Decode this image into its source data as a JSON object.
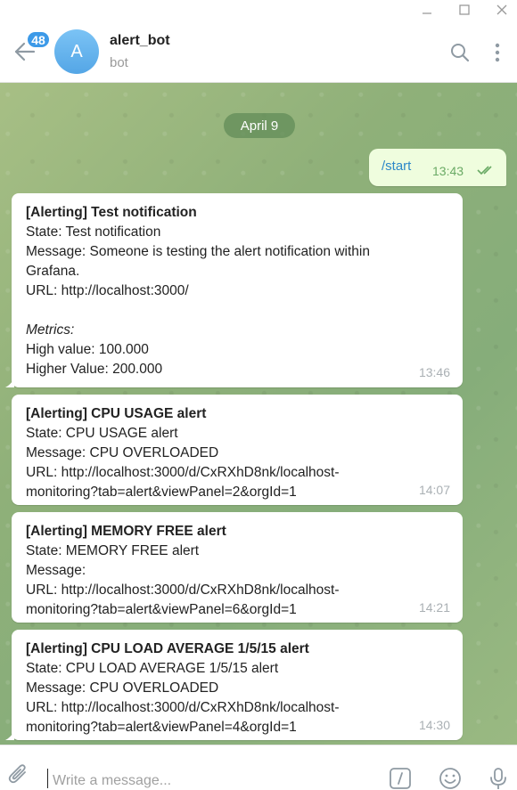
{
  "window": {
    "minimize_icon": "minimize-icon",
    "maximize_icon": "maximize-icon",
    "close_icon": "close-icon"
  },
  "header": {
    "unread_count": "48",
    "avatar_letter": "A",
    "title": "alert_bot",
    "subtitle": "bot"
  },
  "chat": {
    "date": "April 9",
    "outgoing": {
      "text": "/start",
      "time": "13:43"
    },
    "messages": [
      {
        "lines": [
          "[Alerting] Test notification",
          "State: Test notification",
          "Message: Someone is testing the alert notification within",
          "Grafana.",
          "URL: http://localhost:3000/",
          "",
          "Metrics:",
          "High value: 100.000",
          "Higher Value: 200.000"
        ],
        "time": "13:46"
      },
      {
        "lines": [
          "[Alerting] CPU USAGE alert",
          "State: CPU USAGE alert",
          "Message: CPU OVERLOADED",
          "URL: http://localhost:3000/d/CxRXhD8nk/localhost-",
          "monitoring?tab=alert&viewPanel=2&orgId=1"
        ],
        "time": "14:07"
      },
      {
        "lines": [
          "[Alerting] MEMORY FREE alert",
          "State: MEMORY FREE alert",
          "Message:",
          "URL: http://localhost:3000/d/CxRXhD8nk/localhost-",
          "monitoring?tab=alert&viewPanel=6&orgId=1"
        ],
        "time": "14:21"
      },
      {
        "lines": [
          "[Alerting] CPU LOAD AVERAGE 1/5/15 alert",
          "State: CPU LOAD AVERAGE 1/5/15 alert",
          "Message: CPU OVERLOADED",
          "URL: http://localhost:3000/d/CxRXhD8nk/localhost-",
          "monitoring?tab=alert&viewPanel=4&orgId=1"
        ],
        "time": "14:30"
      }
    ]
  },
  "input": {
    "placeholder": "Write a message..."
  },
  "colors": {
    "accent": "#3d9ae8",
    "outgoing_bubble": "#effdde",
    "outgoing_time": "#6aaa65"
  }
}
